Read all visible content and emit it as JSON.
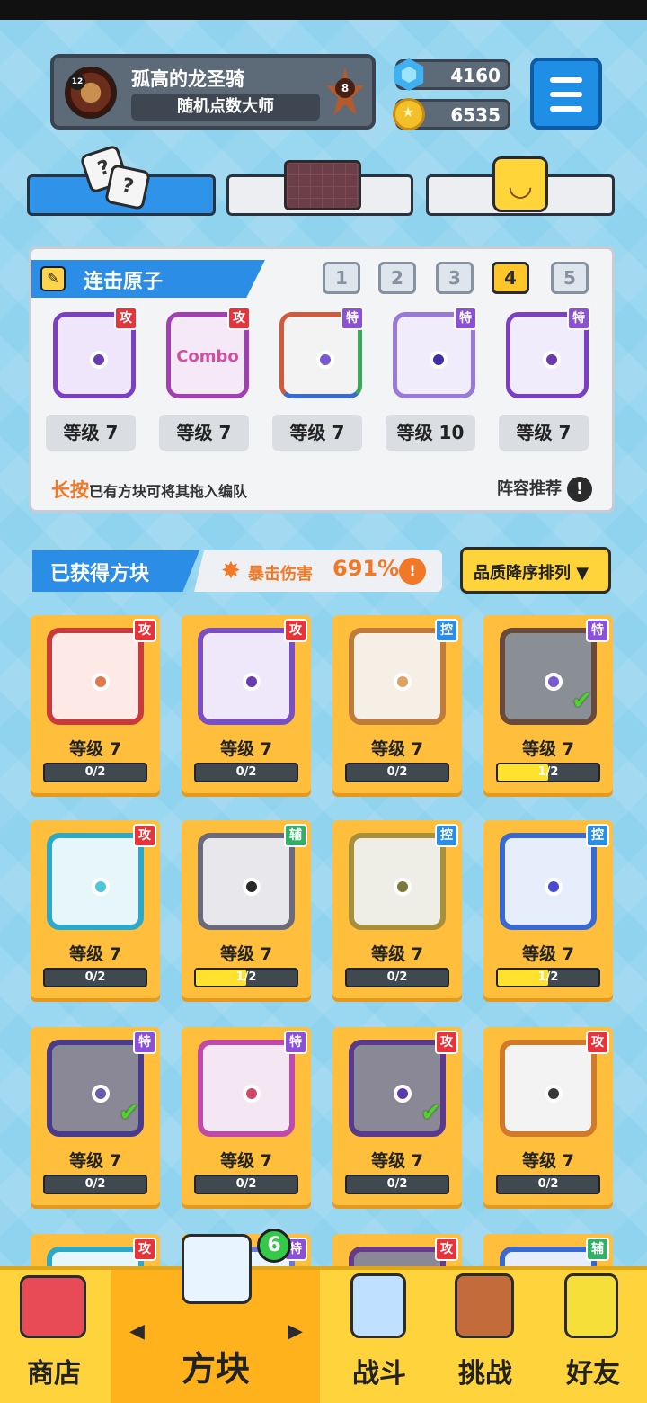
{
  "profile": {
    "name": "孤高的龙圣骑",
    "title": "随机点数大师",
    "avatar_level": "12",
    "rank": "8"
  },
  "currency": {
    "gems": "4160",
    "coins": "6535"
  },
  "loadout": {
    "title": "连击原子",
    "slots": [
      "1",
      "2",
      "3",
      "4",
      "5"
    ],
    "active_slot": "4",
    "cards": [
      {
        "type": "攻",
        "level": "等级 7"
      },
      {
        "type": "攻",
        "level": "等级 7",
        "art_text": "Combo"
      },
      {
        "type": "特",
        "level": "等级 7"
      },
      {
        "type": "特",
        "level": "等级 10"
      },
      {
        "type": "特",
        "level": "等级 7"
      }
    ],
    "hint_highlight": "长按",
    "hint_text": "已有方块可将其拖入编队",
    "recommend_label": "阵容推荐",
    "recommend_icon": "!"
  },
  "collected": {
    "title": "已获得方块",
    "crit_label": "暴击伤害",
    "crit_value": "691%",
    "crit_info": "!",
    "sort_label": "品质降序排列 ▼"
  },
  "blocks": [
    {
      "type": "攻",
      "level": "等级 7",
      "progress": "0/2",
      "fill": 0
    },
    {
      "type": "攻",
      "level": "等级 7",
      "progress": "0/2",
      "fill": 0
    },
    {
      "type": "控",
      "level": "等级 7",
      "progress": "0/2",
      "fill": 0
    },
    {
      "type": "特",
      "level": "等级 7",
      "progress": "1/2",
      "fill": 0.5
    },
    {
      "type": "攻",
      "level": "等级 7",
      "progress": "0/2",
      "fill": 0
    },
    {
      "type": "辅",
      "level": "等级 7",
      "progress": "1/2",
      "fill": 0.5
    },
    {
      "type": "控",
      "level": "等级 7",
      "progress": "0/2",
      "fill": 0
    },
    {
      "type": "控",
      "level": "等级 7",
      "progress": "1/2",
      "fill": 0.5
    },
    {
      "type": "特",
      "level": "等级 7",
      "progress": "0/2",
      "fill": 0
    },
    {
      "type": "特",
      "level": "等级 7",
      "progress": "0/2",
      "fill": 0
    },
    {
      "type": "攻",
      "level": "等级 7",
      "progress": "0/2",
      "fill": 0
    },
    {
      "type": "攻",
      "level": "等级 7",
      "progress": "0/2",
      "fill": 0
    },
    {
      "type": "攻"
    },
    {
      "type": "特"
    },
    {
      "type": "攻"
    },
    {
      "type": "辅"
    }
  ],
  "nav": {
    "shop": "商店",
    "blocks": "方块",
    "blocks_badge": "6",
    "battle": "战斗",
    "challenge": "挑战",
    "friends": "好友",
    "arrow_left": "◀",
    "arrow_right": "▶"
  },
  "tab_icons": {
    "dice_faces": [
      "?",
      "?"
    ],
    "smile": "◡"
  },
  "colors": {
    "attack": "#e8333a",
    "special": "#8c4fd8",
    "control": "#2a8ee6",
    "support": "#33b067"
  }
}
